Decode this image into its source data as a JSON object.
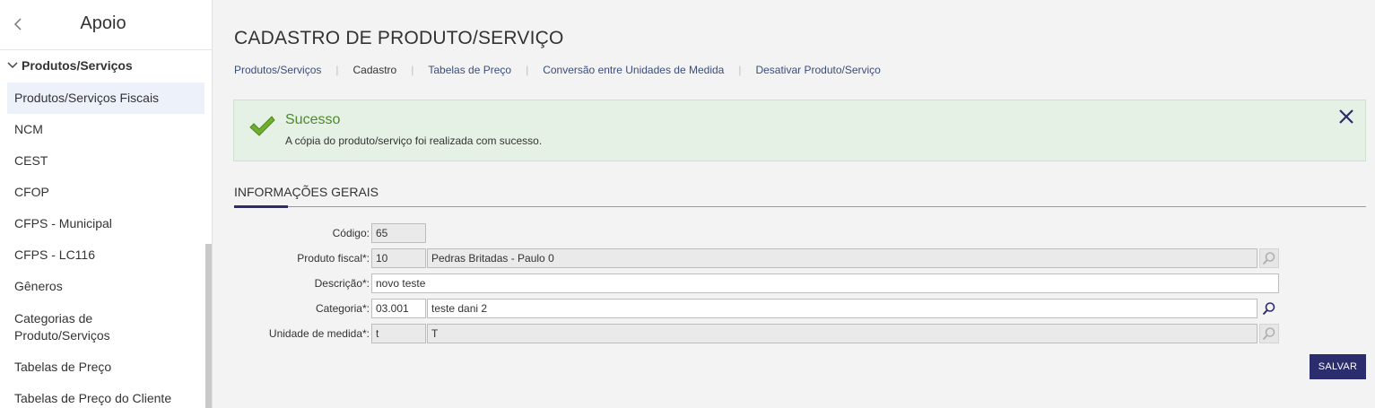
{
  "sidebar": {
    "title": "Apoio",
    "section_label": "Produtos/Serviços",
    "items": [
      {
        "label": "Produtos/Serviços Fiscais"
      },
      {
        "label": "NCM"
      },
      {
        "label": "CEST"
      },
      {
        "label": "CFOP"
      },
      {
        "label": "CFPS - Municipal"
      },
      {
        "label": "CFPS - LC116"
      },
      {
        "label": "Gêneros"
      },
      {
        "label": "Categorias de Produto/Serviços"
      },
      {
        "label": "Tabelas de Preço"
      },
      {
        "label": "Tabelas de Preço do Cliente"
      }
    ]
  },
  "page": {
    "title": "CADASTRO DE PRODUTO/SERVIÇO"
  },
  "tabs": [
    {
      "label": "Produtos/Serviços"
    },
    {
      "label": "Cadastro"
    },
    {
      "label": "Tabelas de Preço"
    },
    {
      "label": "Conversão entre Unidades de Medida"
    },
    {
      "label": "Desativar Produto/Serviço"
    }
  ],
  "alert": {
    "title": "Sucesso",
    "message": "A cópia do produto/serviço foi realizada com sucesso."
  },
  "section": {
    "title": "INFORMAÇÕES GERAIS"
  },
  "form": {
    "codigo": {
      "label": "Código:",
      "value": "65"
    },
    "produto_fiscal": {
      "label": "Produto fiscal*:",
      "code": "10",
      "description": "Pedras Britadas - Paulo 0"
    },
    "descricao": {
      "label": "Descrição*:",
      "value": "novo teste"
    },
    "categoria": {
      "label": "Categoria*:",
      "code": "03.001",
      "description": "teste dani 2"
    },
    "unidade": {
      "label": "Unidade de medida*:",
      "code": "t",
      "description": "T"
    }
  },
  "actions": {
    "save_label": "SALVAR"
  },
  "colors": {
    "accent": "#2b2d6e",
    "success_bg": "#e6f1e6",
    "success_title": "#4a8a2a",
    "sidebar_active": "#edf1fa"
  },
  "icons": [
    "chevron-left-icon",
    "chevron-down-icon",
    "checkmark-icon",
    "close-icon",
    "search-icon"
  ]
}
